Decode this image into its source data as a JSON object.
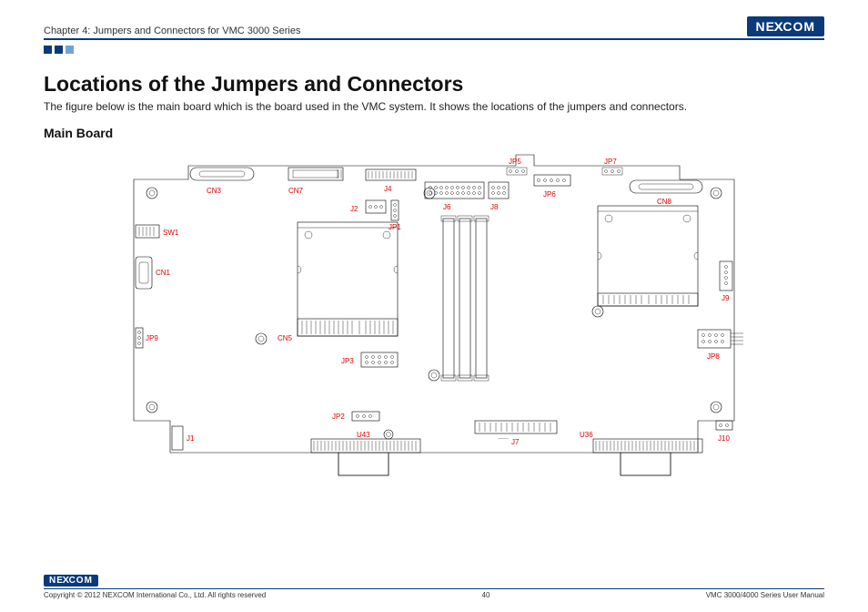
{
  "header": {
    "chapter": "Chapter 4: Jumpers and Connectors for VMC 3000 Series",
    "logo_text": "NE",
    "logo_x": "X",
    "logo_text2": "COM"
  },
  "title": "Locations of the Jumpers and Connectors",
  "description": "The figure below is the main board which is the board used in the VMC system. It shows the locations of the jumpers and connectors.",
  "subtitle": "Main Board",
  "labels": {
    "CN3": "CN3",
    "CN7": "CN7",
    "J4": "J4",
    "JP5": "JP5",
    "JP7": "JP7",
    "J2": "J2",
    "J6": "J6",
    "J8": "J8",
    "JP6": "JP6",
    "CN8": "CN8",
    "SW1": "SW1",
    "JP1": "JP1",
    "CN1": "CN1",
    "J9": "J9",
    "JP9": "JP9",
    "CN5": "CN5",
    "JP8": "JP8",
    "JP3": "JP3",
    "JP2": "JP2",
    "J7": "J7",
    "J10": "J10",
    "J1": "J1",
    "U43": "U43",
    "U36": "U36"
  },
  "footer": {
    "copyright": "Copyright © 2012 NEXCOM International Co., Ltd. All rights reserved",
    "page": "40",
    "doc": "VMC 3000/4000 Series User Manual"
  }
}
